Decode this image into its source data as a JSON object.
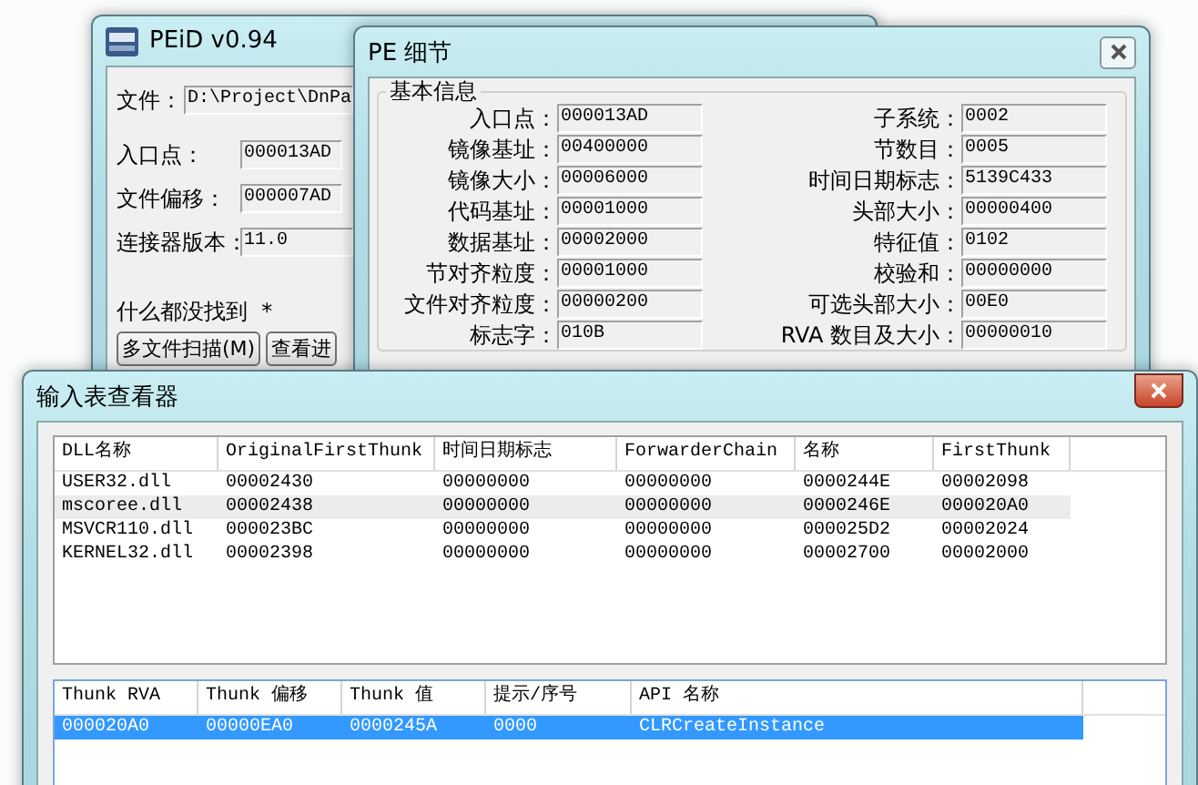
{
  "peid_window": {
    "title": "PEiD v0.94",
    "file_label": "文件：",
    "file_path": "D:\\Project\\DnPa",
    "fields": [
      {
        "label": "入口点：",
        "value": "000013AD"
      },
      {
        "label": "文件偏移：",
        "value": "000007AD"
      },
      {
        "label": "连接器版本：",
        "value": "11.0"
      }
    ],
    "status": "什么都没找到  *",
    "buttons": [
      "多文件扫描(M)",
      "查看进"
    ]
  },
  "pe_details_window": {
    "title": "PE 细节",
    "group": "基本信息",
    "left_fields": [
      {
        "label": "入口点：",
        "value": "000013AD"
      },
      {
        "label": "镜像基址：",
        "value": "00400000"
      },
      {
        "label": "镜像大小：",
        "value": "00006000"
      },
      {
        "label": "代码基址：",
        "value": "00001000"
      },
      {
        "label": "数据基址：",
        "value": "00002000"
      },
      {
        "label": "节对齐粒度：",
        "value": "00001000"
      },
      {
        "label": "文件对齐粒度：",
        "value": "00000200"
      },
      {
        "label": "标志字：",
        "value": "010B"
      }
    ],
    "right_fields": [
      {
        "label": "子系统：",
        "value": "0002"
      },
      {
        "label": "节数目：",
        "value": "0005"
      },
      {
        "label": "时间日期标志：",
        "value": "5139C433"
      },
      {
        "label": "头部大小：",
        "value": "00000400"
      },
      {
        "label": "特征值：",
        "value": "0102"
      },
      {
        "label": "校验和：",
        "value": "00000000"
      },
      {
        "label": "可选头部大小：",
        "value": "00E0"
      },
      {
        "label": "RVA 数目及大小：",
        "value": "00000010"
      }
    ]
  },
  "import_viewer": {
    "title": "输入表查看器",
    "dll_table": {
      "focused": false,
      "columns": [
        "DLL名称",
        "OriginalFirstThunk",
        "时间日期标志",
        "ForwarderChain",
        "名称",
        "FirstThunk"
      ],
      "rows": [
        {
          "cells": [
            "USER32.dll",
            "00002430",
            "00000000",
            "00000000",
            "0000244E",
            "00002098"
          ],
          "selected": false
        },
        {
          "cells": [
            "mscoree.dll",
            "00002438",
            "00000000",
            "00000000",
            "0000246E",
            "000020A0"
          ],
          "selected": true
        },
        {
          "cells": [
            "MSVCR110.dll",
            "000023BC",
            "00000000",
            "00000000",
            "000025D2",
            "00002024"
          ],
          "selected": false
        },
        {
          "cells": [
            "KERNEL32.dll",
            "00002398",
            "00000000",
            "00000000",
            "00002700",
            "00002000"
          ],
          "selected": false
        }
      ]
    },
    "thunk_table": {
      "focused": true,
      "columns": [
        "Thunk RVA",
        "Thunk 偏移",
        "Thunk 值",
        "提示/序号",
        "API 名称"
      ],
      "rows": [
        {
          "cells": [
            "000020A0",
            "00000EA0",
            "0000245A",
            "0000",
            "CLRCreateInstance"
          ],
          "selected": true
        }
      ]
    }
  }
}
